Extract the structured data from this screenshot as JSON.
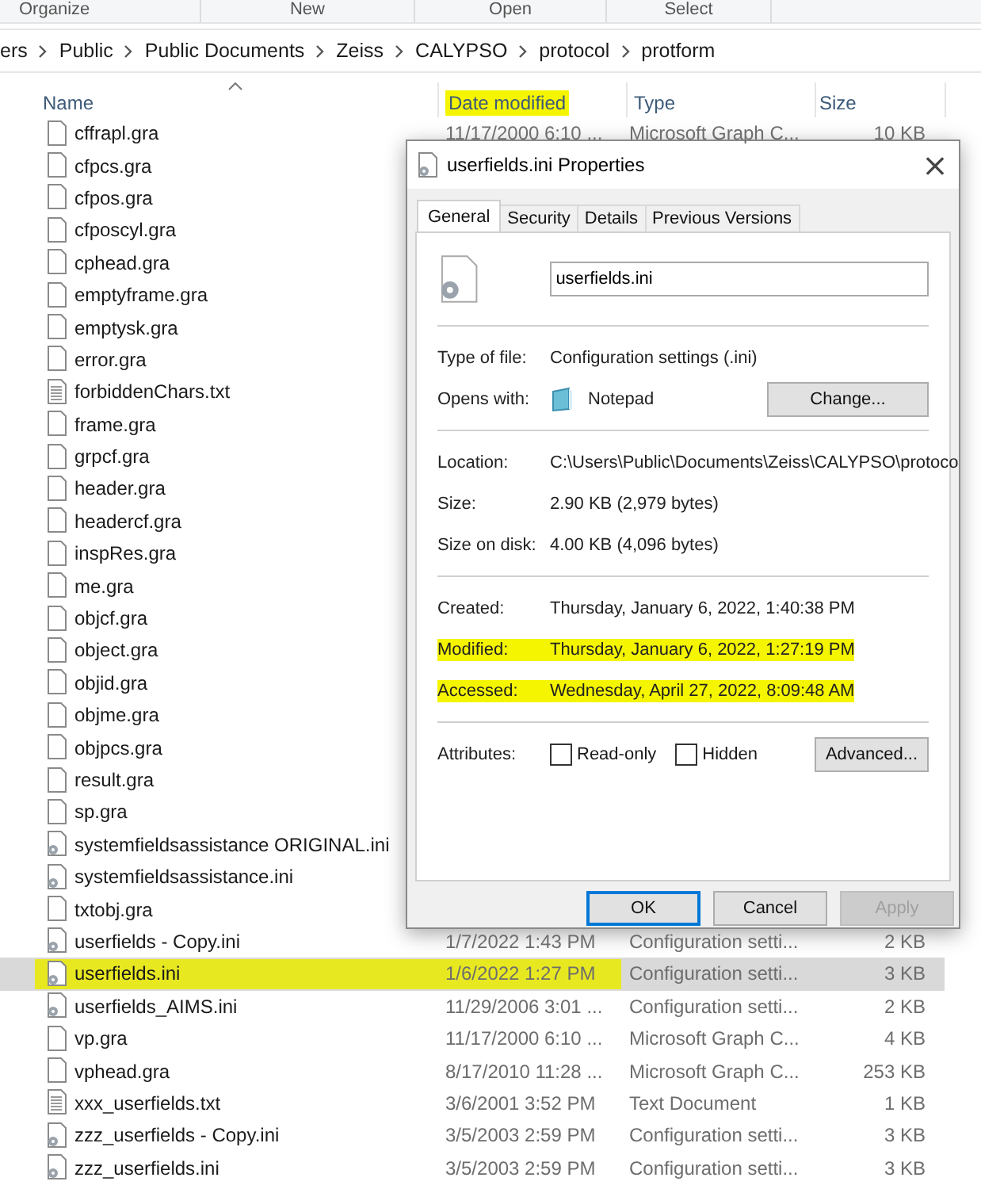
{
  "ribbon": {
    "groups": [
      "Organize",
      "New",
      "Open",
      "Select"
    ]
  },
  "breadcrumb": [
    "ers",
    "Public",
    "Public Documents",
    "Zeiss",
    "CALYPSO",
    "protocol",
    "protform"
  ],
  "columns": [
    {
      "label": "Name",
      "sorted": true,
      "highlighted": false
    },
    {
      "label": "Date modified",
      "sorted": false,
      "highlighted": true
    },
    {
      "label": "Type",
      "sorted": false,
      "highlighted": false
    },
    {
      "label": "Size",
      "sorted": false,
      "highlighted": false
    }
  ],
  "rows": [
    {
      "kind": "blank",
      "name": "cffrapl.gra",
      "date": "11/17/2000 6:10 ...",
      "type": "Microsoft Graph C...",
      "size": "10 KB",
      "selected": false,
      "highlighted": false
    },
    {
      "kind": "blank",
      "name": "cfpcs.gra",
      "selected": false,
      "highlighted": false
    },
    {
      "kind": "blank",
      "name": "cfpos.gra",
      "selected": false,
      "highlighted": false
    },
    {
      "kind": "blank",
      "name": "cfposcyl.gra",
      "selected": false,
      "highlighted": false
    },
    {
      "kind": "blank",
      "name": "cphead.gra",
      "selected": false,
      "highlighted": false
    },
    {
      "kind": "blank",
      "name": "emptyframe.gra",
      "selected": false,
      "highlighted": false
    },
    {
      "kind": "blank",
      "name": "emptysk.gra",
      "selected": false,
      "highlighted": false
    },
    {
      "kind": "blank",
      "name": "error.gra",
      "selected": false,
      "highlighted": false
    },
    {
      "kind": "text",
      "name": "forbiddenChars.txt",
      "selected": false,
      "highlighted": false
    },
    {
      "kind": "blank",
      "name": "frame.gra",
      "selected": false,
      "highlighted": false
    },
    {
      "kind": "blank",
      "name": "grpcf.gra",
      "selected": false,
      "highlighted": false
    },
    {
      "kind": "blank",
      "name": "header.gra",
      "selected": false,
      "highlighted": false
    },
    {
      "kind": "blank",
      "name": "headercf.gra",
      "selected": false,
      "highlighted": false
    },
    {
      "kind": "blank",
      "name": "inspRes.gra",
      "selected": false,
      "highlighted": false
    },
    {
      "kind": "blank",
      "name": "me.gra",
      "selected": false,
      "highlighted": false
    },
    {
      "kind": "blank",
      "name": "objcf.gra",
      "selected": false,
      "highlighted": false
    },
    {
      "kind": "blank",
      "name": "object.gra",
      "selected": false,
      "highlighted": false
    },
    {
      "kind": "blank",
      "name": "objid.gra",
      "selected": false,
      "highlighted": false
    },
    {
      "kind": "blank",
      "name": "objme.gra",
      "selected": false,
      "highlighted": false
    },
    {
      "kind": "blank",
      "name": "objpcs.gra",
      "selected": false,
      "highlighted": false
    },
    {
      "kind": "blank",
      "name": "result.gra",
      "selected": false,
      "highlighted": false
    },
    {
      "kind": "blank",
      "name": "sp.gra",
      "selected": false,
      "highlighted": false
    },
    {
      "kind": "settings",
      "name": "systemfieldsassistance ORIGINAL.ini",
      "selected": false,
      "highlighted": false
    },
    {
      "kind": "settings",
      "name": "systemfieldsassistance.ini",
      "selected": false,
      "highlighted": false
    },
    {
      "kind": "blank",
      "name": "txtobj.gra",
      "selected": false,
      "highlighted": false
    },
    {
      "kind": "settings",
      "name": "userfields - Copy.ini",
      "date": "1/7/2022 1:43 PM",
      "type": "Configuration setti...",
      "size": "2 KB",
      "selected": false,
      "highlighted": false
    },
    {
      "kind": "settings",
      "name": "userfields.ini",
      "date": "1/6/2022 1:27 PM",
      "type": "Configuration setti...",
      "size": "3 KB",
      "selected": true,
      "highlighted": true
    },
    {
      "kind": "settings",
      "name": "userfields_AIMS.ini",
      "date": "11/29/2006 3:01 ...",
      "type": "Configuration setti...",
      "size": "2 KB",
      "selected": false,
      "highlighted": false
    },
    {
      "kind": "blank",
      "name": "vp.gra",
      "date": "11/17/2000 6:10 ...",
      "type": "Microsoft Graph C...",
      "size": "4 KB",
      "selected": false,
      "highlighted": false
    },
    {
      "kind": "blank",
      "name": "vphead.gra",
      "date": "8/17/2010 11:28 ...",
      "type": "Microsoft Graph C...",
      "size": "253 KB",
      "selected": false,
      "highlighted": false
    },
    {
      "kind": "text",
      "name": "xxx_userfields.txt",
      "date": "3/6/2001 3:52 PM",
      "type": "Text Document",
      "size": "1 KB",
      "selected": false,
      "highlighted": false
    },
    {
      "kind": "settings",
      "name": "zzz_userfields - Copy.ini",
      "date": "3/5/2003 2:59 PM",
      "type": "Configuration setti...",
      "size": "3 KB",
      "selected": false,
      "highlighted": false
    },
    {
      "kind": "settings",
      "name": "zzz_userfields.ini",
      "date": "3/5/2003 2:59 PM",
      "type": "Configuration setti...",
      "size": "3 KB",
      "selected": false,
      "highlighted": false
    }
  ],
  "dialog": {
    "title": "userfields.ini Properties",
    "close": "×",
    "tabs": [
      {
        "label": "General",
        "selected": true
      },
      {
        "label": "Security",
        "selected": false
      },
      {
        "label": "Details",
        "selected": false
      },
      {
        "label": "Previous Versions",
        "selected": false
      }
    ],
    "file_name": "userfields.ini",
    "sections": [
      [
        {
          "label": "Type of file:",
          "value": "Configuration settings (.ini)",
          "highlighted": false
        },
        {
          "label": "Opens with:",
          "value": "Notepad",
          "button": "Change...",
          "highlighted": false
        }
      ],
      [
        {
          "label": "Location:",
          "value": "C:\\Users\\Public\\Documents\\Zeiss\\CALYPSO\\protoco",
          "highlighted": false
        },
        {
          "label": "Size:",
          "value": "2.90 KB (2,979 bytes)",
          "highlighted": false
        },
        {
          "label": "Size on disk:",
          "value": "4.00 KB (4,096 bytes)",
          "highlighted": false
        }
      ],
      [
        {
          "label": "Created:",
          "value": "Thursday, January 6, 2022, 1:40:38 PM",
          "highlighted": false
        },
        {
          "label": "Modified:",
          "value": "Thursday, January 6, 2022, 1:27:19 PM",
          "highlighted": true
        },
        {
          "label": "Accessed:",
          "value": "Wednesday, April 27, 2022, 8:09:48 AM",
          "highlighted": true
        }
      ]
    ],
    "attributes": {
      "label": "Attributes:",
      "options": [
        {
          "label": "Read-only",
          "checked": false
        },
        {
          "label": "Hidden",
          "checked": false
        }
      ],
      "button": "Advanced..."
    },
    "buttons": [
      {
        "label": "OK",
        "default": true,
        "disabled": false
      },
      {
        "label": "Cancel",
        "default": false,
        "disabled": false
      },
      {
        "label": "Apply",
        "default": false,
        "disabled": true
      }
    ]
  }
}
